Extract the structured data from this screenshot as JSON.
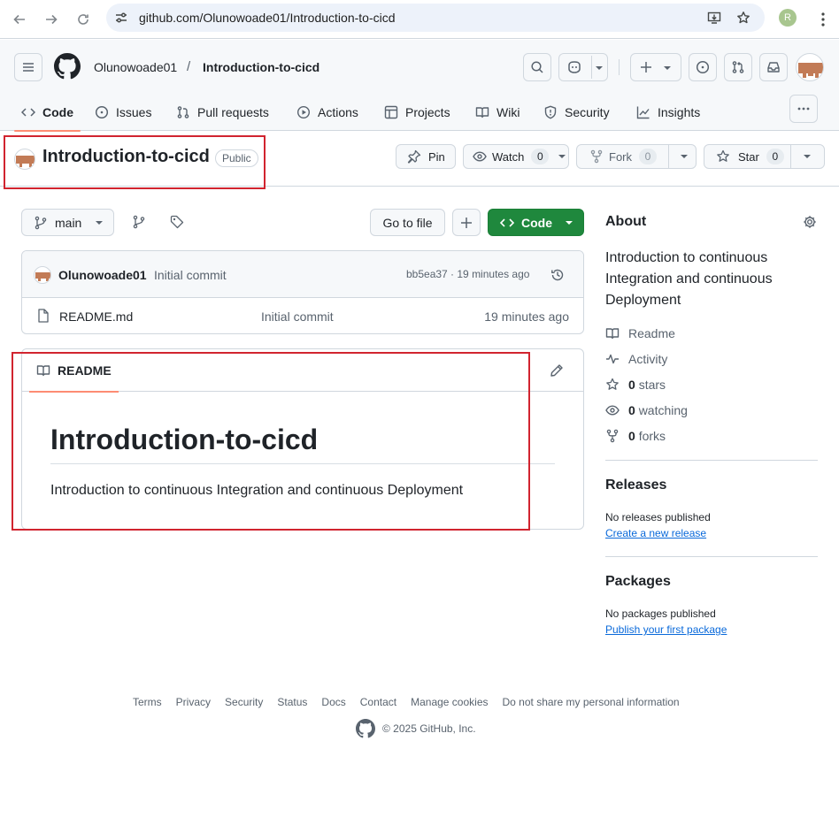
{
  "browser": {
    "url": "github.com/Olunowoade01/Introduction-to-cicd",
    "profile_initial": "R"
  },
  "header": {
    "owner": "Olunowoade01",
    "separator": "/",
    "repo": "Introduction-to-cicd"
  },
  "repo_nav": {
    "tabs": [
      {
        "label": "Code",
        "icon": "code-icon"
      },
      {
        "label": "Issues",
        "icon": "issue-icon"
      },
      {
        "label": "Pull requests",
        "icon": "pull-request-icon"
      },
      {
        "label": "Actions",
        "icon": "play-icon"
      },
      {
        "label": "Projects",
        "icon": "table-icon"
      },
      {
        "label": "Wiki",
        "icon": "book-icon"
      },
      {
        "label": "Security",
        "icon": "shield-icon"
      },
      {
        "label": "Insights",
        "icon": "graph-icon"
      }
    ]
  },
  "title_row": {
    "name": "Introduction-to-cicd",
    "visibility": "Public",
    "pin_label": "Pin",
    "watch_label": "Watch",
    "watch_count": "0",
    "fork_label": "Fork",
    "fork_count": "0",
    "star_label": "Star",
    "star_count": "0"
  },
  "toolbar": {
    "branch": "main",
    "go_to_file": "Go to file",
    "code_label": "Code"
  },
  "latest_commit": {
    "author": "Olunowoade01",
    "message": "Initial commit",
    "meta": "bb5ea37 · 19 minutes ago"
  },
  "files": [
    {
      "name": "README.md",
      "commit": "Initial commit",
      "time": "19 minutes ago"
    }
  ],
  "readme": {
    "tab_label": "README",
    "heading": "Introduction-to-cicd",
    "body": "Introduction to continuous Integration and continuous Deployment"
  },
  "about": {
    "heading": "About",
    "description": "Introduction to continuous Integration and continuous Deployment",
    "readme": "Readme",
    "activity": "Activity",
    "stars_count": "0",
    "stars_label": "stars",
    "watching_count": "0",
    "watching_label": "watching",
    "forks_count": "0",
    "forks_label": "forks"
  },
  "releases": {
    "heading": "Releases",
    "empty": "No releases published",
    "link": "Create a new release"
  },
  "packages": {
    "heading": "Packages",
    "empty": "No packages published",
    "link": "Publish your first package"
  },
  "footer": {
    "links": [
      "Terms",
      "Privacy",
      "Security",
      "Status",
      "Docs",
      "Contact",
      "Manage cookies",
      "Do not share my personal information"
    ],
    "copyright": "© 2025 GitHub, Inc."
  },
  "colors": {
    "accent_green": "#1f883d",
    "highlight_red": "#d1242f",
    "tab_underline": "#fd8c73",
    "link_blue": "#0969da"
  }
}
